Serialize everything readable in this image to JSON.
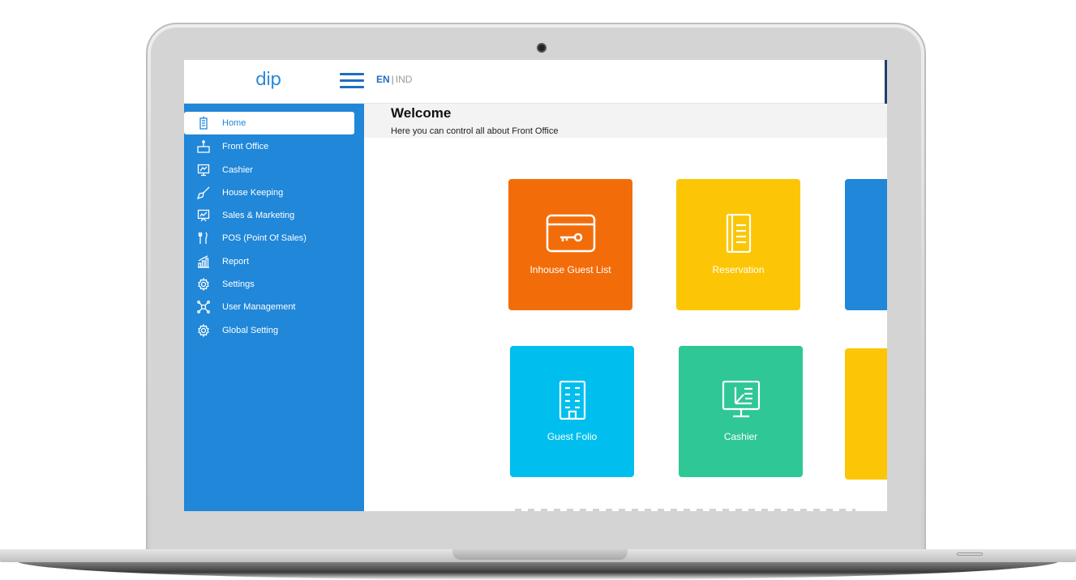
{
  "topbar": {
    "logo": "dip",
    "lang_active": "EN",
    "lang_separator": "|",
    "lang_other": "IND"
  },
  "sidebar": {
    "items": [
      {
        "label": "Home",
        "icon": "building-icon",
        "active": true
      },
      {
        "label": "Front Office",
        "icon": "front-desk-icon",
        "active": false
      },
      {
        "label": "Cashier",
        "icon": "monitor-icon",
        "active": false
      },
      {
        "label": "House Keeping",
        "icon": "broom-icon",
        "active": false
      },
      {
        "label": "Sales & Marketing",
        "icon": "presentation-icon",
        "active": false
      },
      {
        "label": "POS (Point Of Sales)",
        "icon": "cutlery-icon",
        "active": false
      },
      {
        "label": "Report",
        "icon": "chart-icon",
        "active": false
      },
      {
        "label": "Settings",
        "icon": "gear-icon",
        "active": false
      },
      {
        "label": "User Management",
        "icon": "network-icon",
        "active": false
      },
      {
        "label": "Global Setting",
        "icon": "gear-icon",
        "active": false
      }
    ]
  },
  "main": {
    "title": "Welcome",
    "subtitle": "Here you can control all about Front Office",
    "tiles": [
      {
        "label": "Inhouse Guest List",
        "icon": "key-card-icon",
        "color": "#f26d0a"
      },
      {
        "label": "Reservation",
        "icon": "book-icon",
        "color": "#fcc606"
      },
      {
        "label": "",
        "icon": "",
        "color": "#2087d9"
      },
      {
        "label": "Guest Folio",
        "icon": "building-icon",
        "color": "#00bfee"
      },
      {
        "label": "Cashier",
        "icon": "monitor-icon",
        "color": "#2ec795"
      },
      {
        "label": "",
        "icon": "",
        "color": "#fcc606"
      }
    ]
  },
  "colors": {
    "sidebar": "#2087d9",
    "accent": "#1f6fbf"
  }
}
